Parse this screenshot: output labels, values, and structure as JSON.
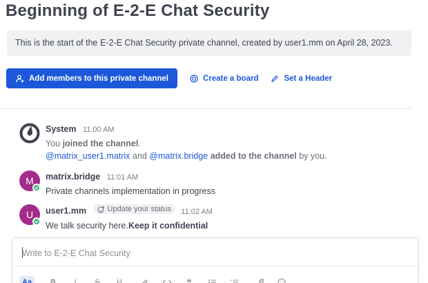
{
  "channel": {
    "title": "Beginning of E-2-E Chat Security",
    "intro": "This is the start of the E-2-E Chat Security private channel, created by user1.mm on April 28, 2023."
  },
  "actions": {
    "add_members": "Add members to this private channel",
    "create_board": "Create a board",
    "set_header": "Set a Header"
  },
  "posts": [
    {
      "author": "System",
      "time": "11:00 AM",
      "line1_prefix": "You",
      "line1_strong": "joined the channel",
      "line1_suffix": ".",
      "mention1": "@matrix_user1.matrix",
      "and": "and",
      "mention2": "@matrix.bridge",
      "added": "added to the channel",
      "by_you": "by you."
    },
    {
      "author": "matrix.bridge",
      "avatar_letter": "M",
      "avatar_color": "#a32b89",
      "time": "11:01 AM",
      "text": "Private channels implementation in progress"
    },
    {
      "author": "user1.mm",
      "avatar_letter": "U",
      "avatar_color": "#a32b89",
      "status_chip": "Update your status",
      "time": "11:02 AM",
      "text_plain": "We talk security here.",
      "text_bold": "Keep it confidential"
    }
  ],
  "composer": {
    "placeholder": "Write to E-2-E Chat Security",
    "aa_label": "Aa",
    "bold_label": "B",
    "italic_label": "I",
    "strike_label": "S",
    "heading_label": "H",
    "quote_label": "❝"
  },
  "colors": {
    "accent": "#1c58d9",
    "online": "#3db887",
    "intro_bg": "#f0f1f3"
  }
}
